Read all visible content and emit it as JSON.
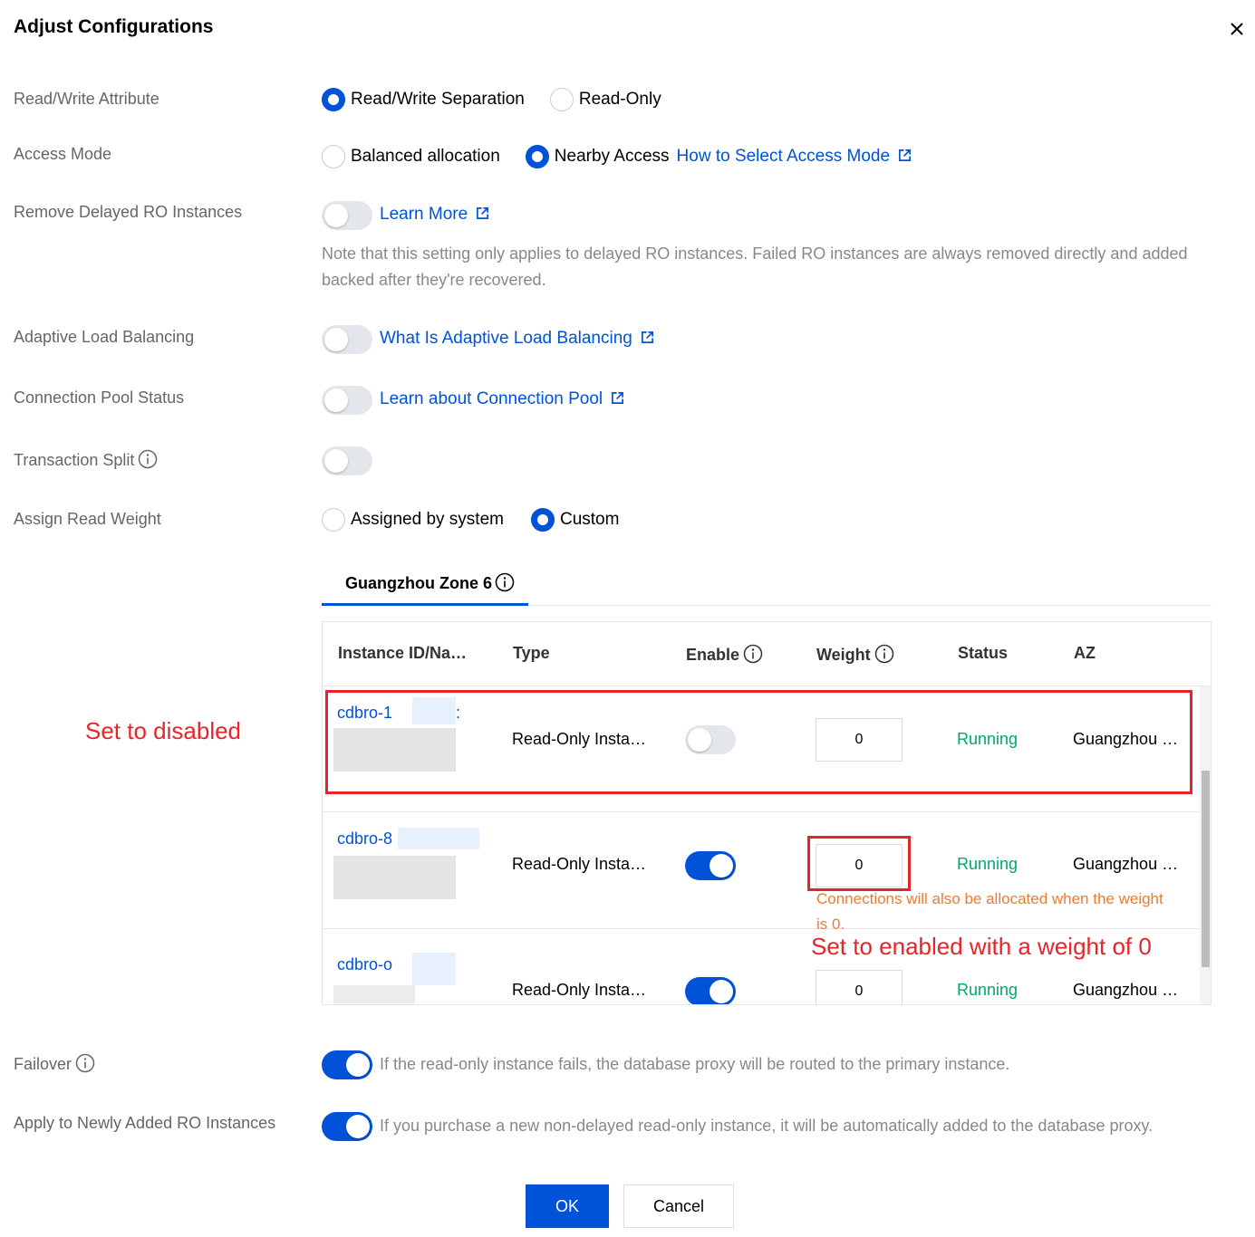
{
  "dialog": {
    "title": "Adjust Configurations"
  },
  "rows": {
    "rw_attribute": {
      "label": "Read/Write Attribute",
      "options": [
        "Read/Write Separation",
        "Read-Only"
      ],
      "selected": "Read/Write Separation"
    },
    "access_mode": {
      "label": "Access Mode",
      "options": [
        "Balanced allocation",
        "Nearby Access"
      ],
      "selected": "Nearby Access",
      "link": "How to Select Access Mode"
    },
    "remove_delayed": {
      "label": "Remove Delayed RO Instances",
      "enabled": false,
      "link": "Learn More",
      "note": "Note that this setting only applies to delayed RO instances. Failed RO instances are always removed directly and added backed after they're recovered."
    },
    "adaptive_lb": {
      "label": "Adaptive Load Balancing",
      "enabled": false,
      "link": "What Is Adaptive Load Balancing"
    },
    "connection_pool": {
      "label": "Connection Pool Status",
      "enabled": false,
      "link": "Learn about Connection Pool"
    },
    "transaction_split": {
      "label": "Transaction Split",
      "enabled": false
    },
    "read_weight": {
      "label": "Assign Read Weight",
      "options": [
        "Assigned by system",
        "Custom"
      ],
      "selected": "Custom"
    },
    "failover": {
      "label": "Failover",
      "enabled": true,
      "hint": "If the read-only instance fails, the database proxy will be routed to the primary instance."
    },
    "apply_new": {
      "label": "Apply to Newly Added RO Instances",
      "enabled": true,
      "hint": "If you purchase a new non-delayed read-only instance, it will be automatically added to the database proxy."
    }
  },
  "zone_tab": {
    "label": "Guangzhou Zone 6"
  },
  "table": {
    "columns": [
      "Instance ID/Na…",
      "Type",
      "Enable",
      "Weight",
      "Status",
      "AZ"
    ],
    "rows": [
      {
        "id": "cdbro-1",
        "id_suffix": ":",
        "type": "Read-Only Insta…",
        "enabled": false,
        "weight": "0",
        "status": "Running",
        "az": "Guangzhou …"
      },
      {
        "id": "cdbro-8",
        "id_suffix": ":",
        "type": "Read-Only Insta…",
        "enabled": true,
        "weight": "0",
        "status": "Running",
        "az": "Guangzhou …",
        "warning": "Connections will also be allocated when the weight is 0."
      },
      {
        "id": "cdbro-o",
        "id_suffix": "",
        "type": "Read-Only Insta…",
        "enabled": true,
        "weight": "0",
        "status": "Running",
        "az": "Guangzhou …"
      }
    ]
  },
  "annotations": {
    "disabled_note": "Set to disabled",
    "enabled_note": "Set to enabled with a weight of 0",
    "color": "#e5252a"
  },
  "buttons": {
    "ok": "OK",
    "cancel": "Cancel"
  },
  "colors": {
    "primary": "#0052d9",
    "running": "#00a870",
    "warning": "#ed7b2f"
  }
}
